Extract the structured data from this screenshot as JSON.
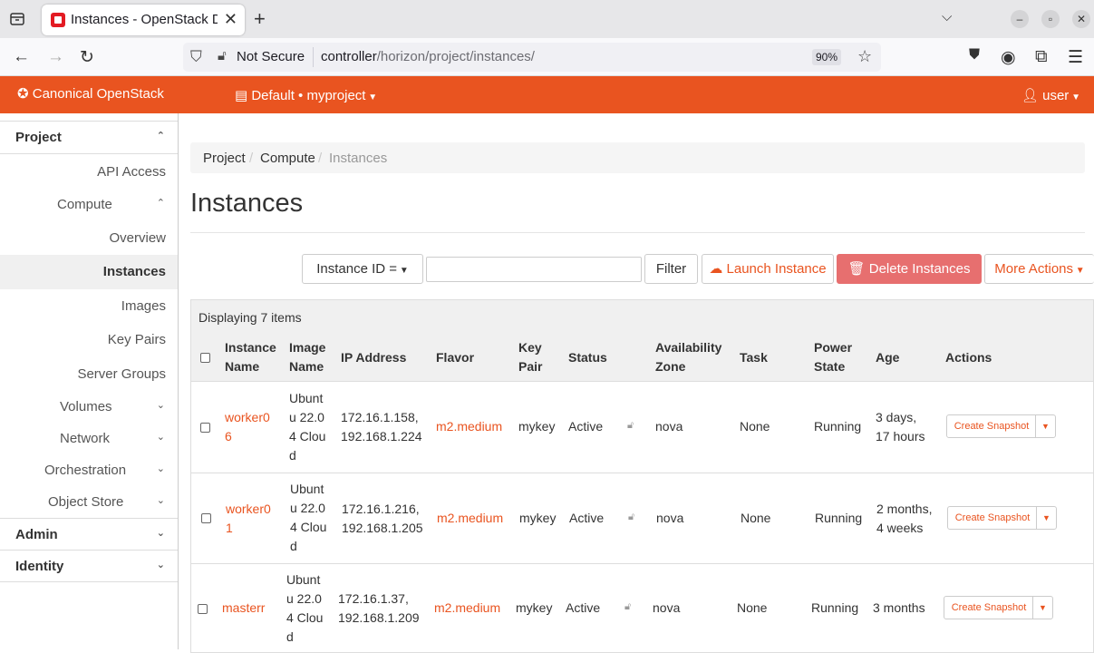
{
  "browser": {
    "tab_title": "Instances - OpenStack Dashboard",
    "not_secure": "Not Secure",
    "url_host": "controller",
    "url_path": "/horizon/project/instances/",
    "zoom": "90%"
  },
  "header": {
    "brand": "Canonical OpenStack",
    "project": "Default • myproject",
    "user": "user"
  },
  "sidebar": {
    "project": "Project",
    "api_access": "API Access",
    "compute": "Compute",
    "overview": "Overview",
    "instances": "Instances",
    "images": "Images",
    "key_pairs": "Key Pairs",
    "server_groups": "Server Groups",
    "volumes": "Volumes",
    "network": "Network",
    "orchestration": "Orchestration",
    "object_store": "Object Store",
    "admin": "Admin",
    "identity": "Identity"
  },
  "breadcrumb": [
    "Project",
    "Compute",
    "Instances"
  ],
  "page_title": "Instances",
  "toolbar": {
    "filter_field": "Instance ID =",
    "filter_btn": "Filter",
    "launch": "Launch Instance",
    "delete": "Delete Instances",
    "more": "More Actions"
  },
  "table": {
    "count": "Displaying 7 items",
    "headers": {
      "name": [
        "Instance",
        "Name"
      ],
      "image": [
        "Image",
        "Name"
      ],
      "ip": "IP Address",
      "flavor": "Flavor",
      "key": [
        "Key",
        "Pair"
      ],
      "status": "Status",
      "az": [
        "Availability",
        "Zone"
      ],
      "task": "Task",
      "power": [
        "Power",
        "State"
      ],
      "age": "Age",
      "actions": "Actions"
    },
    "rows": [
      {
        "name": [
          "worker0",
          "6"
        ],
        "image": [
          "Ubunt",
          "u 22.0",
          "4 Clou",
          "d"
        ],
        "ip": [
          "172.16.1.158,",
          "192.168.1.224"
        ],
        "flavor": "m2.medium",
        "key": "mykey",
        "status": "Active",
        "az": "nova",
        "task": "None",
        "power": "Running",
        "age": [
          "3 days,",
          "17 hours"
        ],
        "action": "Create Snapshot"
      },
      {
        "name": [
          "worker0",
          "1"
        ],
        "image": [
          "Ubunt",
          "u 22.0",
          "4 Clou",
          "d"
        ],
        "ip": [
          "172.16.1.216,",
          "192.168.1.205"
        ],
        "flavor": "m2.medium",
        "key": "mykey",
        "status": "Active",
        "az": "nova",
        "task": "None",
        "power": "Running",
        "age": [
          "2 months,",
          "4 weeks"
        ],
        "action": "Create Snapshot"
      },
      {
        "name": [
          "masterr"
        ],
        "image": [
          "Ubunt",
          "u 22.0",
          "4 Clou",
          "d"
        ],
        "ip": [
          "172.16.1.37,",
          "192.168.1.209"
        ],
        "flavor": "m2.medium",
        "key": "mykey",
        "status": "Active",
        "az": "nova",
        "task": "None",
        "power": "Running",
        "age": [
          "3 months"
        ],
        "action": "Create Snapshot"
      }
    ]
  }
}
